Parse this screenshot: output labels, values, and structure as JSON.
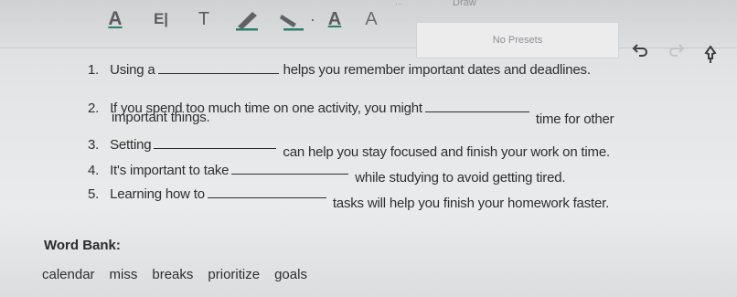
{
  "toolbar": {
    "tab_prev_label": "...",
    "tab_draw_label": "Draw",
    "presets_label": "No Presets",
    "tools": [
      {
        "name": "text-color-icon",
        "glyph": "A"
      },
      {
        "name": "text-style-icon",
        "glyph": "E|"
      },
      {
        "name": "text-tool-icon",
        "glyph": "T"
      },
      {
        "name": "pen-icon",
        "glyph": ""
      },
      {
        "name": "highlighter-icon",
        "glyph": ""
      },
      {
        "name": "dot-icon",
        "glyph": "·"
      },
      {
        "name": "font-color-a-icon",
        "glyph": "A"
      },
      {
        "name": "font-size-a-icon",
        "glyph": "A"
      }
    ],
    "accent_color": "#2f7d6b"
  },
  "questions": [
    {
      "number": "1.",
      "before": "Using a",
      "after": "helps you remember important dates and deadlines.",
      "continuation": ""
    },
    {
      "number": "2.",
      "before": "If you spend too much time on one activity, you might",
      "after": "time for other",
      "continuation": "important things."
    },
    {
      "number": "3.",
      "before": "Setting",
      "after": "can help you stay focused and finish your work on time.",
      "continuation": ""
    },
    {
      "number": "4.",
      "before": "It's important to take",
      "after": "while studying to avoid getting tired.",
      "continuation": ""
    },
    {
      "number": "5.",
      "before": "Learning how to",
      "after": "tasks will help you finish your homework faster.",
      "continuation": ""
    }
  ],
  "word_bank": {
    "title": "Word Bank:",
    "words": [
      "calendar",
      "miss",
      "breaks",
      "prioritize",
      "goals"
    ]
  }
}
